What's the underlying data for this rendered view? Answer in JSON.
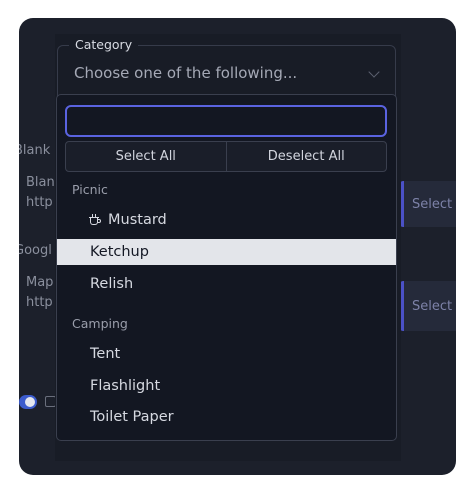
{
  "category": {
    "legend": "Category",
    "value": "Choose one of the following..."
  },
  "search": {
    "value": "",
    "placeholder": ""
  },
  "actions": {
    "select_all": "Select All",
    "deselect_all": "Deselect All"
  },
  "groups": [
    {
      "label": "Picnic",
      "options": [
        {
          "label": "Mustard",
          "icon": "coffee-cup-icon"
        },
        {
          "label": "Ketchup",
          "selected": true
        },
        {
          "label": "Relish"
        }
      ]
    },
    {
      "label": "Camping",
      "options": [
        {
          "label": "Tent"
        },
        {
          "label": "Flashlight"
        },
        {
          "label": "Toilet Paper"
        }
      ]
    }
  ],
  "background": {
    "left_labels": [
      "Blank",
      "Blan",
      "http",
      "Googl",
      "Map",
      "http"
    ],
    "card_label_1": "Select I",
    "card_label_2": "Select I"
  },
  "colors": {
    "accent": "#5a63e0",
    "selected_row": "#e3e5ea",
    "panel": "#131722"
  }
}
